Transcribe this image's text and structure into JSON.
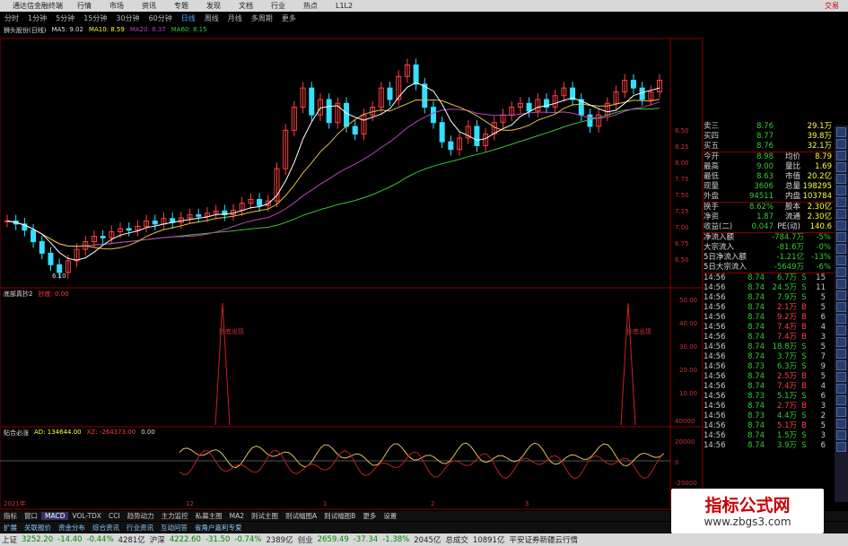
{
  "menu": {
    "title": "通达信金融终端",
    "items": [
      "行情",
      "市场",
      "资讯",
      "专题",
      "发现",
      "文档",
      "行业",
      "热点",
      "L1L2"
    ],
    "trade": "交易"
  },
  "periods": [
    "分时",
    "1分钟",
    "5分钟",
    "15分钟",
    "30分钟",
    "60分钟",
    "日线",
    "周线",
    "月线",
    "多周期",
    "更多"
  ],
  "main_header": {
    "name": "狮头股份(日线)",
    "ma5": "MA5: 9.02",
    "ma10": "MA10: 8.59",
    "ma20": "MA20: 8.37",
    "ma60": "MA60: 8.15"
  },
  "main_axis": [
    "8.50",
    "8.25",
    "8.00",
    "7.75",
    "7.50",
    "7.25",
    "7.00",
    "6.75",
    "6.50"
  ],
  "low_label": "6.10",
  "date_marks": [
    "2021年",
    "12",
    "1",
    "2",
    "3"
  ],
  "ind1": {
    "name": "底部真抄2",
    "value": "抄底: 0.00",
    "axis": [
      "50.00",
      "40.00",
      "30.00",
      "20.00",
      "10.00"
    ],
    "signal": "抄底出现"
  },
  "ind2": {
    "name": "贴合必涨",
    "ad": "AD: 134644.00",
    "xz": "XZ: -264373.00",
    "zero": "0.00",
    "axis": [
      "40000",
      "20000",
      "0",
      "-20000"
    ]
  },
  "quote": [
    {
      "l": "卖三",
      "p": "8.76",
      "r": "",
      "v": "29.1万"
    },
    {
      "l": "买四",
      "p": "8.77",
      "r": "",
      "v": "39.8万"
    },
    {
      "l": "买五",
      "p": "8.76",
      "r": "",
      "v": "32.1万"
    },
    {
      "l": "今开",
      "p": "8.98",
      "r": "均价",
      "v": "8.79"
    },
    {
      "l": "最高",
      "p": "9.00",
      "r": "量比",
      "v": "1.69"
    },
    {
      "l": "最低",
      "p": "8.63",
      "r": "市值",
      "v": "20.2亿"
    },
    {
      "l": "现量",
      "p": "3606",
      "r": "总量",
      "v": "198295"
    },
    {
      "l": "外盘",
      "p": "94511",
      "r": "内盘",
      "v": "103784"
    },
    {
      "l": "换手",
      "p": "8.62%",
      "r": "股本",
      "v": "2.30亿"
    },
    {
      "l": "净资",
      "p": "1.87",
      "r": "流通",
      "v": "2.30亿"
    },
    {
      "l": "收益(二)",
      "p": "0.047",
      "r": "PE(动)",
      "v": "140.6"
    }
  ],
  "flows": [
    {
      "l": "净流入额",
      "v": "-784.7万",
      "pct": "-5%"
    },
    {
      "l": "大宗流入",
      "v": "-81.6万",
      "pct": "-0%"
    },
    {
      "l": "5日净流入额",
      "v": "-1.21亿",
      "pct": "-13%"
    },
    {
      "l": "5日大宗流入",
      "v": "-5649万",
      "pct": "-6%"
    }
  ],
  "ticks": [
    {
      "t": "14:56",
      "p": "8.74",
      "v": "6.7万",
      "b": "S",
      "n": "15"
    },
    {
      "t": "14:56",
      "p": "8.74",
      "v": "24.5万",
      "b": "S",
      "n": "11"
    },
    {
      "t": "14:56",
      "p": "8.74",
      "v": "7.9万",
      "b": "S",
      "n": "5"
    },
    {
      "t": "14:56",
      "p": "8.74",
      "v": "2.1万",
      "b": "B",
      "n": "5"
    },
    {
      "t": "14:56",
      "p": "8.74",
      "v": "9.2万",
      "b": "B",
      "n": "6"
    },
    {
      "t": "14:56",
      "p": "8.74",
      "v": "7.4万",
      "b": "B",
      "n": "4"
    },
    {
      "t": "14:56",
      "p": "8.74",
      "v": "7.4万",
      "b": "B",
      "n": "3"
    },
    {
      "t": "14:56",
      "p": "8.74",
      "v": "18.8万",
      "b": "S",
      "n": "5"
    },
    {
      "t": "14:56",
      "p": "8.74",
      "v": "3.7万",
      "b": "S",
      "n": "7"
    },
    {
      "t": "14:56",
      "p": "8.73",
      "v": "6.3万",
      "b": "S",
      "n": "9"
    },
    {
      "t": "14:56",
      "p": "8.74",
      "v": "2.5万",
      "b": "B",
      "n": "5"
    },
    {
      "t": "14:56",
      "p": "8.74",
      "v": "7.4万",
      "b": "B",
      "n": "4"
    },
    {
      "t": "14:56",
      "p": "8.73",
      "v": "5.1万",
      "b": "S",
      "n": "6"
    },
    {
      "t": "14:56",
      "p": "8.74",
      "v": "2.7万",
      "b": "B",
      "n": "3"
    },
    {
      "t": "14:56",
      "p": "8.73",
      "v": "4.4万",
      "b": "S",
      "n": "2"
    },
    {
      "t": "14:56",
      "p": "8.74",
      "v": "5.1万",
      "b": "B",
      "n": "5"
    },
    {
      "t": "14:56",
      "p": "8.74",
      "v": "1.5万",
      "b": "S",
      "n": "3"
    },
    {
      "t": "14:56",
      "p": "8.74",
      "v": "3.9万",
      "b": "S",
      "n": "6"
    }
  ],
  "bottom_tabs": [
    "指标",
    "窗口",
    "MACD",
    "VOL-TDX",
    "CCI",
    "趋势动力",
    "主力监控",
    "私募主图",
    "MA2",
    "则试主图",
    "则试幅图A",
    "则试幅图B",
    "更多",
    "设置"
  ],
  "bottom_tabs2": [
    "扩展",
    "关联报价",
    "资金分布",
    "综合资讯",
    "行业资讯",
    "互动问答",
    "省角户嘉利专爱"
  ],
  "status": [
    {
      "l": "上证",
      "v": "3252.20",
      "c": "-14.40",
      "pct": "-0.44%",
      "amt": "4281亿"
    },
    {
      "l": "沪深",
      "v": "4222.60",
      "c": "-31.50",
      "pct": "-0.74%",
      "amt": "2389亿"
    },
    {
      "l": "创业",
      "v": "2659.49",
      "c": "-37.34",
      "pct": "-1.38%",
      "amt": "2045亿"
    }
  ],
  "status_total": "总成交",
  "status_total_v": "10891亿",
  "status_msg": "平安证券新疆云行情",
  "watermark1": "指标公式网",
  "watermark2": "www.zbgs3.com",
  "colors": {
    "up": "#ff4040",
    "down": "#33e0ff",
    "ma5": "#ffffff",
    "ma10": "#e0c040",
    "ma20": "#c040c0",
    "ma60": "#40c040"
  }
}
